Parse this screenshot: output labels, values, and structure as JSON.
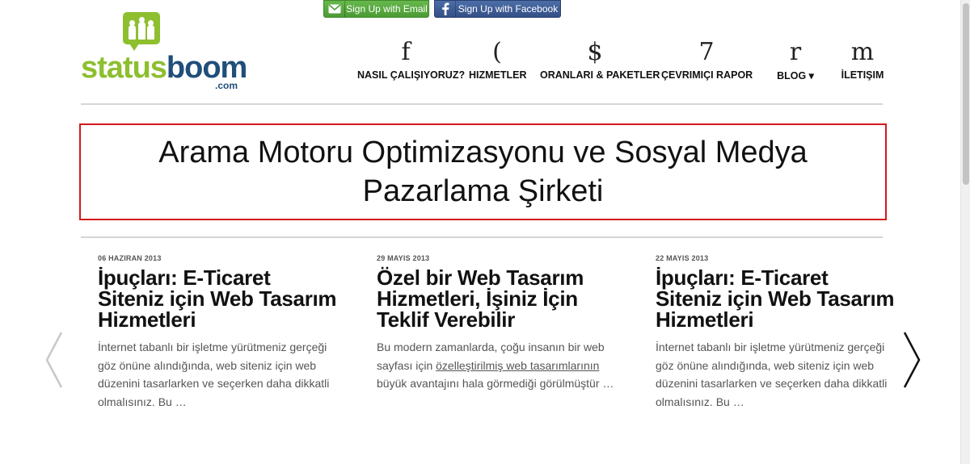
{
  "signup": {
    "email_label": "Sign Up with Email",
    "facebook_label": "Sign Up with Facebook"
  },
  "logo": {
    "status": "status",
    "boom": "boom",
    "com": ".com",
    "colors": {
      "green": "#8dbf2f",
      "navy": "#1f4e79"
    }
  },
  "nav": {
    "items": [
      {
        "glyph": "f",
        "label": "NASIL ÇALIŞIYORUZ?"
      },
      {
        "glyph": "(",
        "label": "HIZMETLER"
      },
      {
        "glyph": "$",
        "label": "ORANLARI & PAKETLER"
      },
      {
        "glyph": "7",
        "label": "ÇEVRIMIÇI RAPOR"
      },
      {
        "glyph": "r",
        "label": "BLOG ▾"
      },
      {
        "glyph": "m",
        "label": "İLETIŞIM"
      }
    ]
  },
  "hero": {
    "title": "Arama Motoru Optimizasyonu ve Sosyal Medya Pazarlama Şirketi",
    "border_color": "#d4171e"
  },
  "posts": [
    {
      "date": "06 HAZIRAN 2013",
      "title": "İpuçları: E-Ticaret Siteniz için Web Tasarım Hizmetleri",
      "excerpt": "İnternet tabanlı bir işletme yürütmeniz gerçeği göz önüne alındığında, web siteniz için web düzenini tasarlarken ve seçerken daha dikkatli olmalısınız. Bu …"
    },
    {
      "date": "29 MAYIS 2013",
      "title": "Özel bir Web Tasarım Hizmetleri, İşiniz İçin Teklif Verebilir",
      "excerpt_before": "Bu modern zamanlarda, çoğu insanın bir web sayfası için ",
      "excerpt_link": "özelleştirilmiş web tasarımlarının",
      "excerpt_after": " büyük avantajını hala görmediği görülmüştür …"
    },
    {
      "date": "22 MAYIS 2013",
      "title": "İpuçları: E-Ticaret Siteniz için Web Tasarım Hizmetleri",
      "excerpt": "İnternet tabanlı bir işletme yürütmeniz gerçeği göz önüne alındığında, web siteniz için web düzenini tasarlarken ve seçerken daha dikkatli olmalısınız. Bu …"
    }
  ],
  "icons": {
    "prev": "chevron-left-icon",
    "next": "chevron-right-icon",
    "email": "envelope-icon",
    "facebook": "facebook-icon"
  }
}
